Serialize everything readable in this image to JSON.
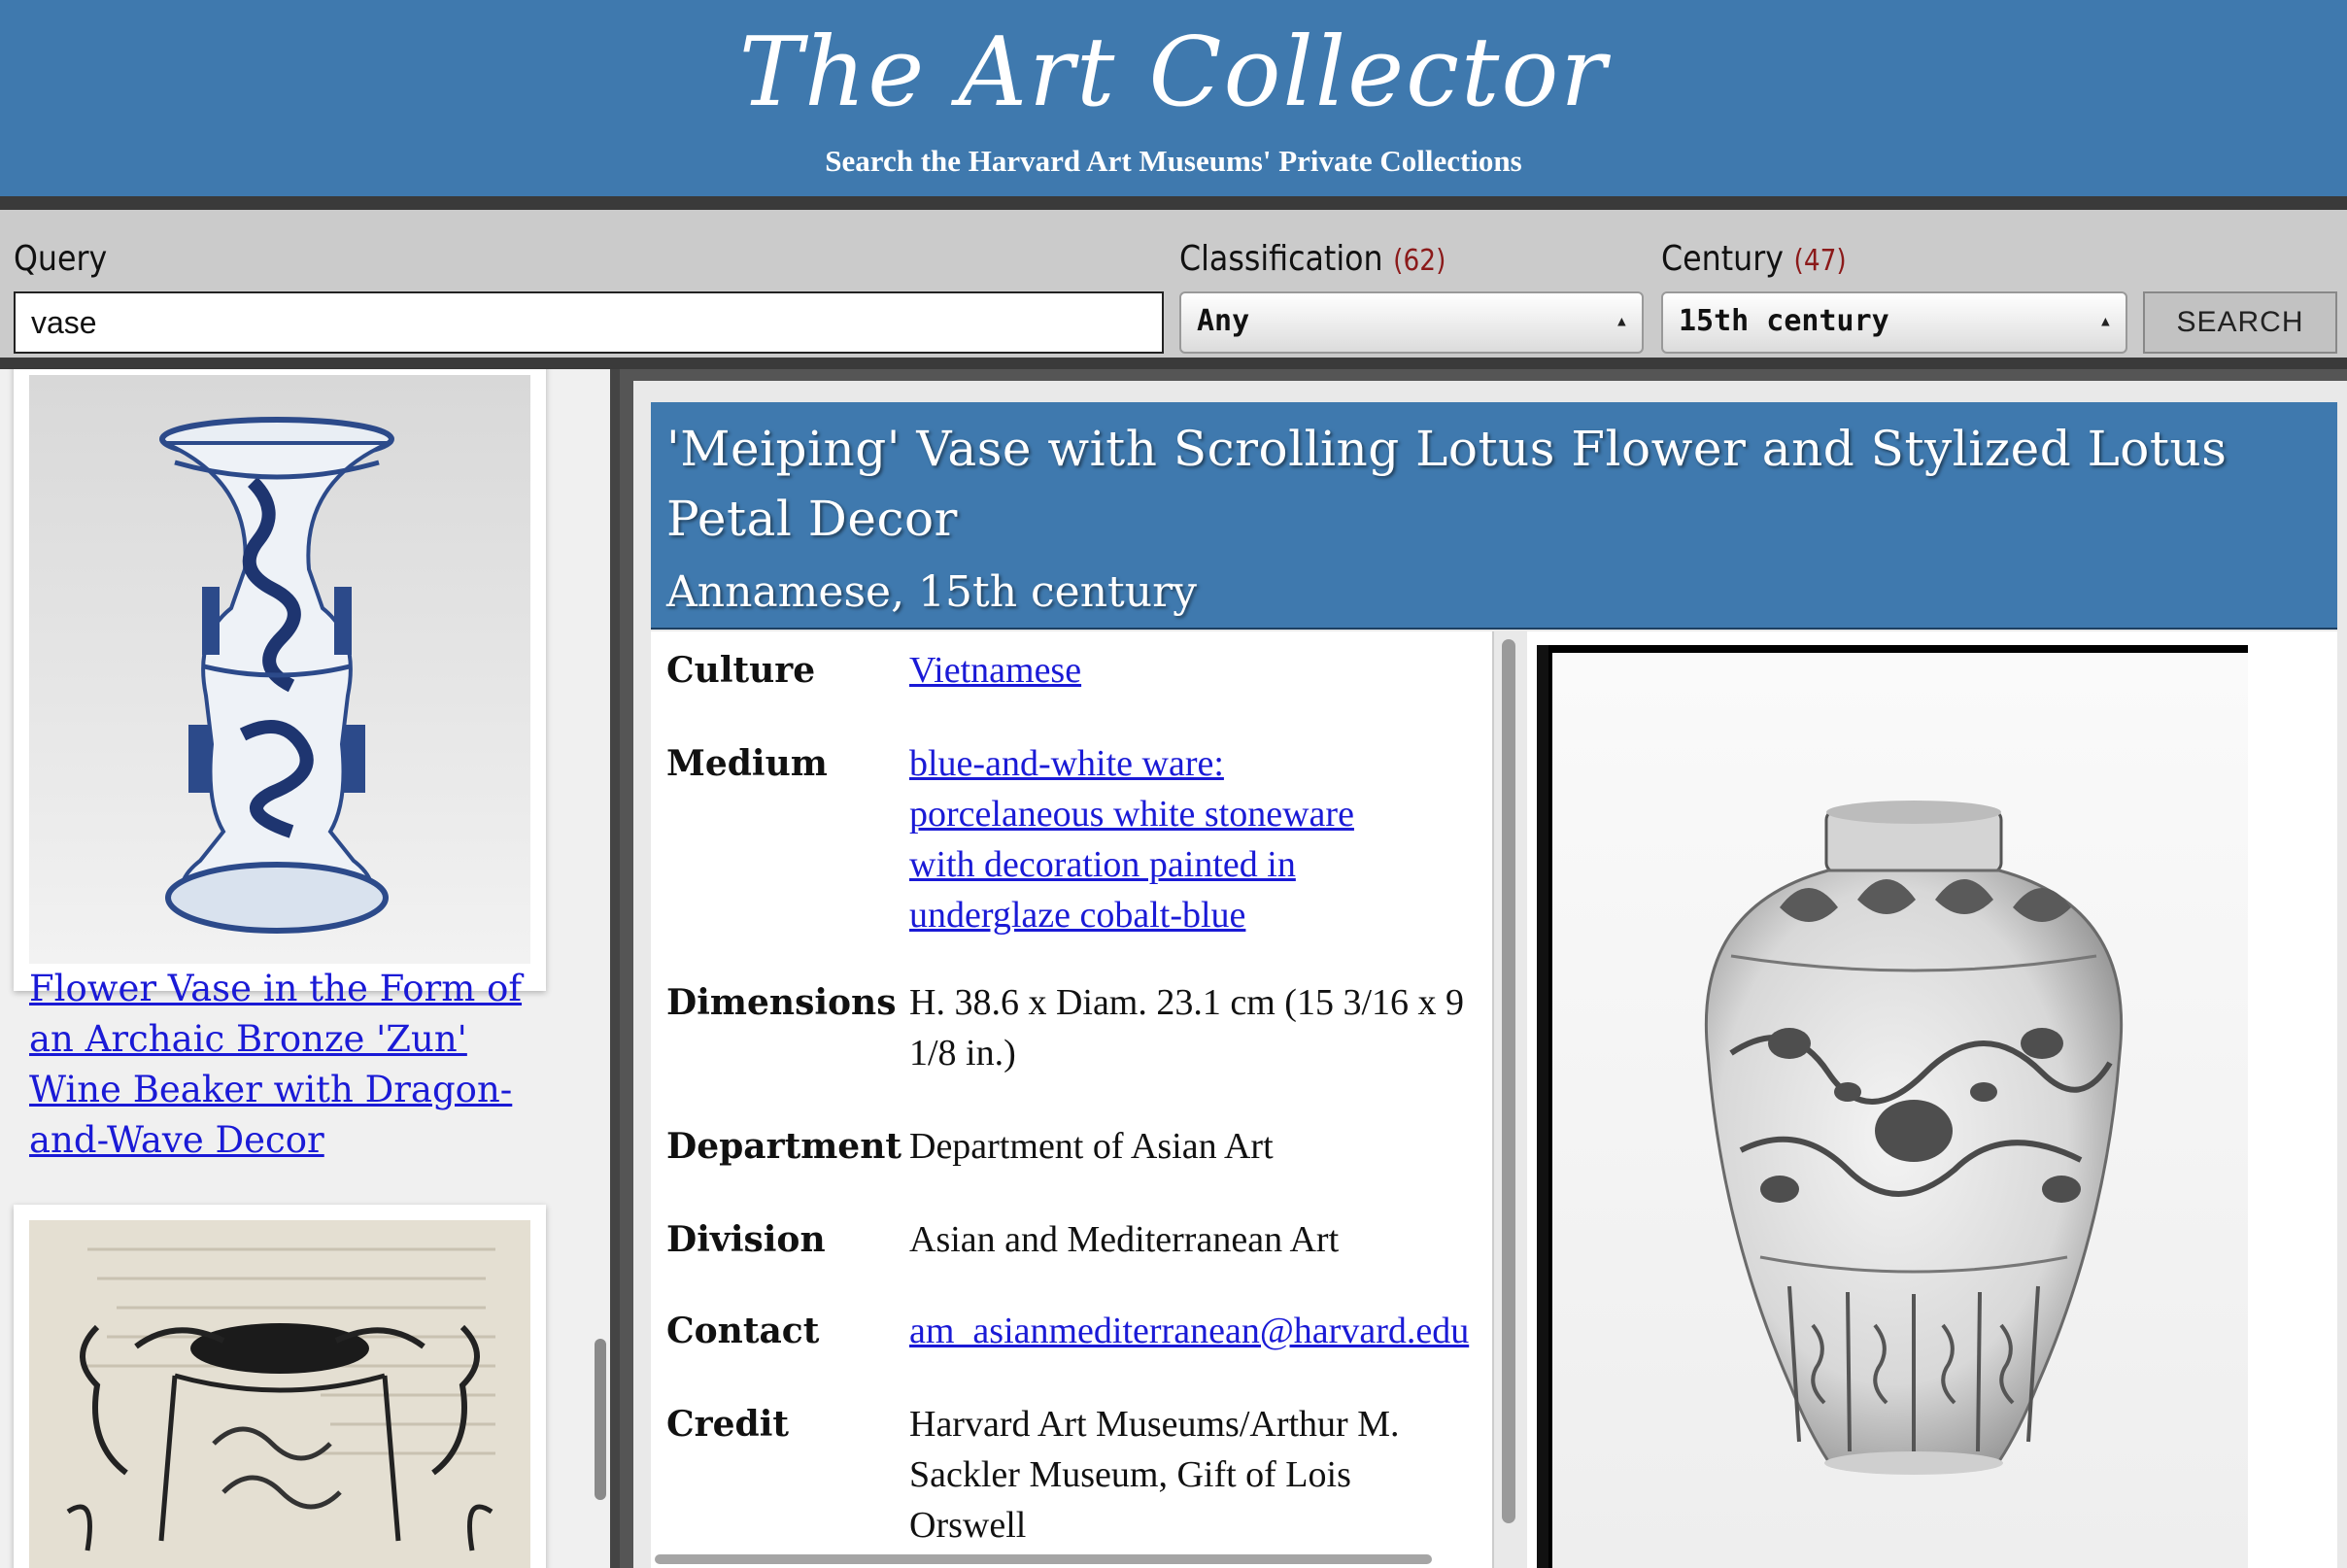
{
  "header": {
    "title": "The Art Collector",
    "subtitle": "Search the Harvard Art Museums' Private Collections"
  },
  "search": {
    "query_label": "Query",
    "query_value": "vase",
    "classification_label": "Classification",
    "classification_count": "(62)",
    "classification_value": "Any",
    "century_label": "Century",
    "century_count": "(47)",
    "century_value": "15th century",
    "search_button": "SEARCH"
  },
  "results": [
    {
      "title": "Flower Vase in the Form of an Archaic Bronze 'Zun' Wine Beaker with Dragon-and-Wave Decor"
    },
    {
      "title": ""
    }
  ],
  "detail": {
    "title": "'Meiping' Vase with Scrolling Lotus Flower and Stylized Lotus Petal Decor",
    "subtitle": "Annamese, 15th century",
    "facts": [
      {
        "key": "Culture",
        "value": "Vietnamese",
        "link": true
      },
      {
        "key": "Medium",
        "value": "blue-and-white ware: porcelaneous white stoneware with decoration painted in underglaze cobalt-blue",
        "link": true
      },
      {
        "key": "Dimensions",
        "value": "H. 38.6 x Diam. 23.1 cm (15 3/16 x 9 1/8 in.)",
        "link": false
      },
      {
        "key": "Department",
        "value": "Department of Asian Art",
        "link": false
      },
      {
        "key": "Division",
        "value": "Asian and Mediterranean Art",
        "link": false
      },
      {
        "key": "Contact",
        "value": "am_asianmediterranean@harvard.edu",
        "link": true
      },
      {
        "key": "Credit",
        "value": "Harvard Art Museums/Arthur M. Sackler Museum, Gift of Lois Orswell",
        "link": false
      }
    ]
  },
  "colors": {
    "header_blue": "#3f79ae",
    "link_blue": "#1a1ad6",
    "count_red": "#8b1a1a"
  },
  "icons": {
    "select_arrows": "updown-arrows-icon"
  }
}
